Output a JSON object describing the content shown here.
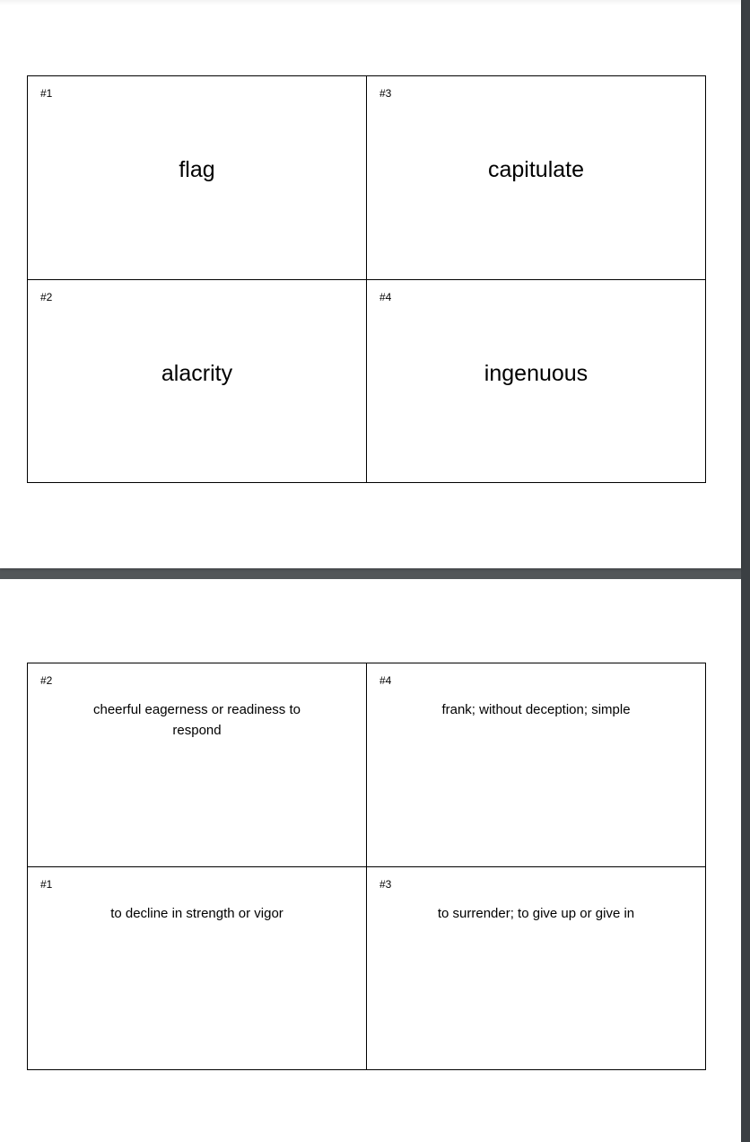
{
  "pages": [
    {
      "cards": [
        {
          "number": "#1",
          "text": "flag"
        },
        {
          "number": "#3",
          "text": "capitulate"
        },
        {
          "number": "#2",
          "text": "alacrity"
        },
        {
          "number": "#4",
          "text": "ingenuous"
        }
      ]
    },
    {
      "cards": [
        {
          "number": "#2",
          "text": "cheerful eagerness or readiness to respond"
        },
        {
          "number": "#4",
          "text": "frank; without deception; simple"
        },
        {
          "number": "#1",
          "text": "to decline in strength or vigor"
        },
        {
          "number": "#3",
          "text": "to surrender; to give up or give in"
        }
      ]
    }
  ]
}
